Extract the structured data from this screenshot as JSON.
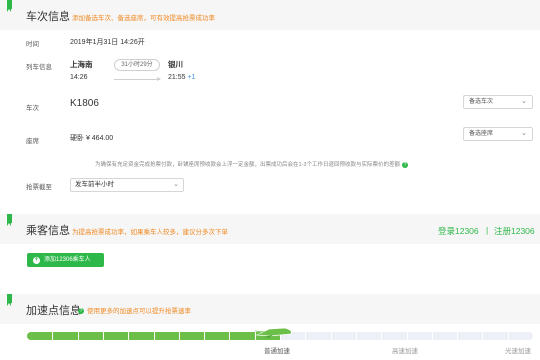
{
  "train_info": {
    "title": "车次信息",
    "hint": "添加备选车次、备选座席，可有效提高抢票成功率",
    "time_label": "时间",
    "date": "2019年1月31日 14:26开",
    "train_label": "列车信息",
    "from_station": "上海南",
    "to_station": "银川",
    "depart_time": "14:26",
    "arrive_time": "21:55",
    "plus_day": "+1",
    "duration": "31小时29分",
    "train_no_label": "车次",
    "train_no": "K1806",
    "alt_train_button": "备选车次",
    "seat_label": "座席",
    "seat_value": "硬卧 ¥ 464.00",
    "alt_seat_button": "备选座席",
    "note": "为确保有充足资金完成抢票付款，卧铺座席预收款会上浮一定金额，出票成功后会在1-3个工作日退回预收款与实际票价的差额",
    "deadline_label": "抢票截至",
    "deadline_value": "发车前半小时"
  },
  "passenger": {
    "title": "乘客信息",
    "hint": "为提高抢票成功率，如果乘车人较多，建议分多次下单",
    "login": "登录12306",
    "separator": "|",
    "register": "注册12306",
    "add_button": "添加12306乘车人"
  },
  "speed": {
    "title": "加速点信息",
    "hint": "使用更多的加速点可以提升抢票速率",
    "level": 0.5,
    "labels": [
      "普通加速",
      "高速加速",
      "光速加速"
    ]
  },
  "colors": {
    "accent": "#2fb84a",
    "hint_orange": "#f08a24",
    "progress_fill": "#6cc04a",
    "progress_track": "#eef0f8"
  },
  "icons": [
    "help-icon",
    "chevron-down-icon",
    "plus-icon",
    "rocket-icon"
  ]
}
